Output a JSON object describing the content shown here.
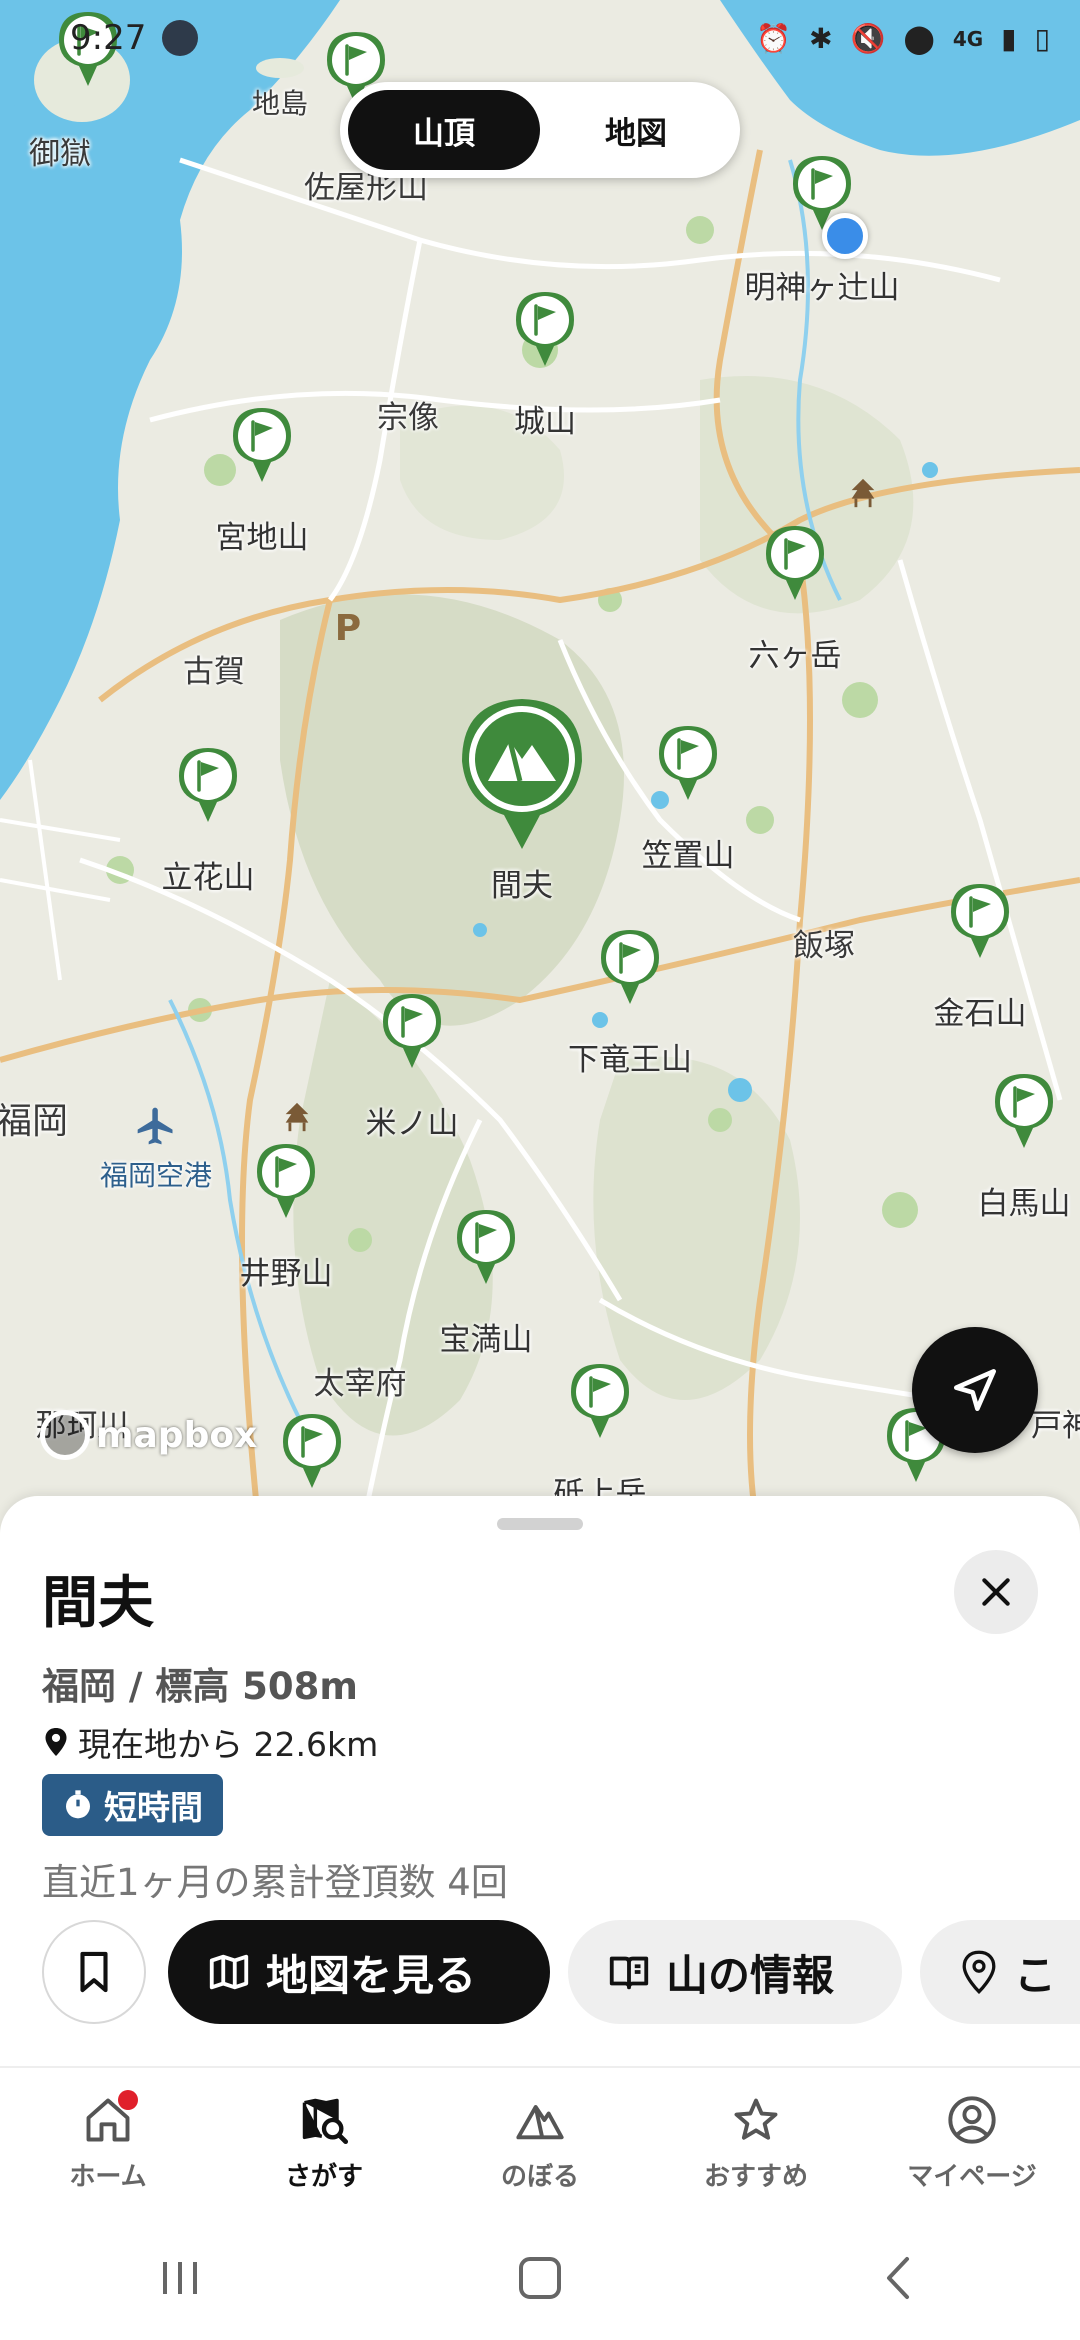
{
  "status_bar": {
    "time": "9:27",
    "network": "4G"
  },
  "segmented": {
    "left": "山頂",
    "right": "地図"
  },
  "map": {
    "places": [
      "御獄",
      "地島",
      "佐屋形山",
      "宗像",
      "古賀",
      "福岡",
      "福岡空港",
      "太宰府",
      "那珂川",
      "飯塚"
    ],
    "parking_label": "P",
    "peaks": [
      "明神ヶ辻山",
      "城山",
      "宮地山",
      "六ヶ岳",
      "立花山",
      "笠置山",
      "下竜王山",
      "金石山",
      "米ノ山",
      "白馬山",
      "井野山",
      "宝満山",
      "砥上岳",
      "戸神"
    ],
    "selected_peak": "間夫",
    "attribution": "mapbox"
  },
  "sheet": {
    "name": "間夫",
    "meta": "福岡 / 標高 508m",
    "distance": "現在地から 22.6km",
    "badge": "短時間",
    "climbs": "直近1ヶ月の累計登頂数 4回",
    "buttons": {
      "view_map": "地図を見る",
      "info": "山の情報",
      "more": "こ"
    }
  },
  "tabs": [
    {
      "label": "ホーム",
      "icon": "home-icon"
    },
    {
      "label": "さがす",
      "icon": "search-map-icon"
    },
    {
      "label": "のぼる",
      "icon": "mountain-icon"
    },
    {
      "label": "おすすめ",
      "icon": "star-icon"
    },
    {
      "label": "マイページ",
      "icon": "profile-icon"
    }
  ],
  "colors": {
    "accent_green": "#3f8a3c",
    "badge_blue": "#2b5c88",
    "sea": "#6cc3e8",
    "user_dot": "#3a8de8",
    "notification": "#e0202b"
  }
}
